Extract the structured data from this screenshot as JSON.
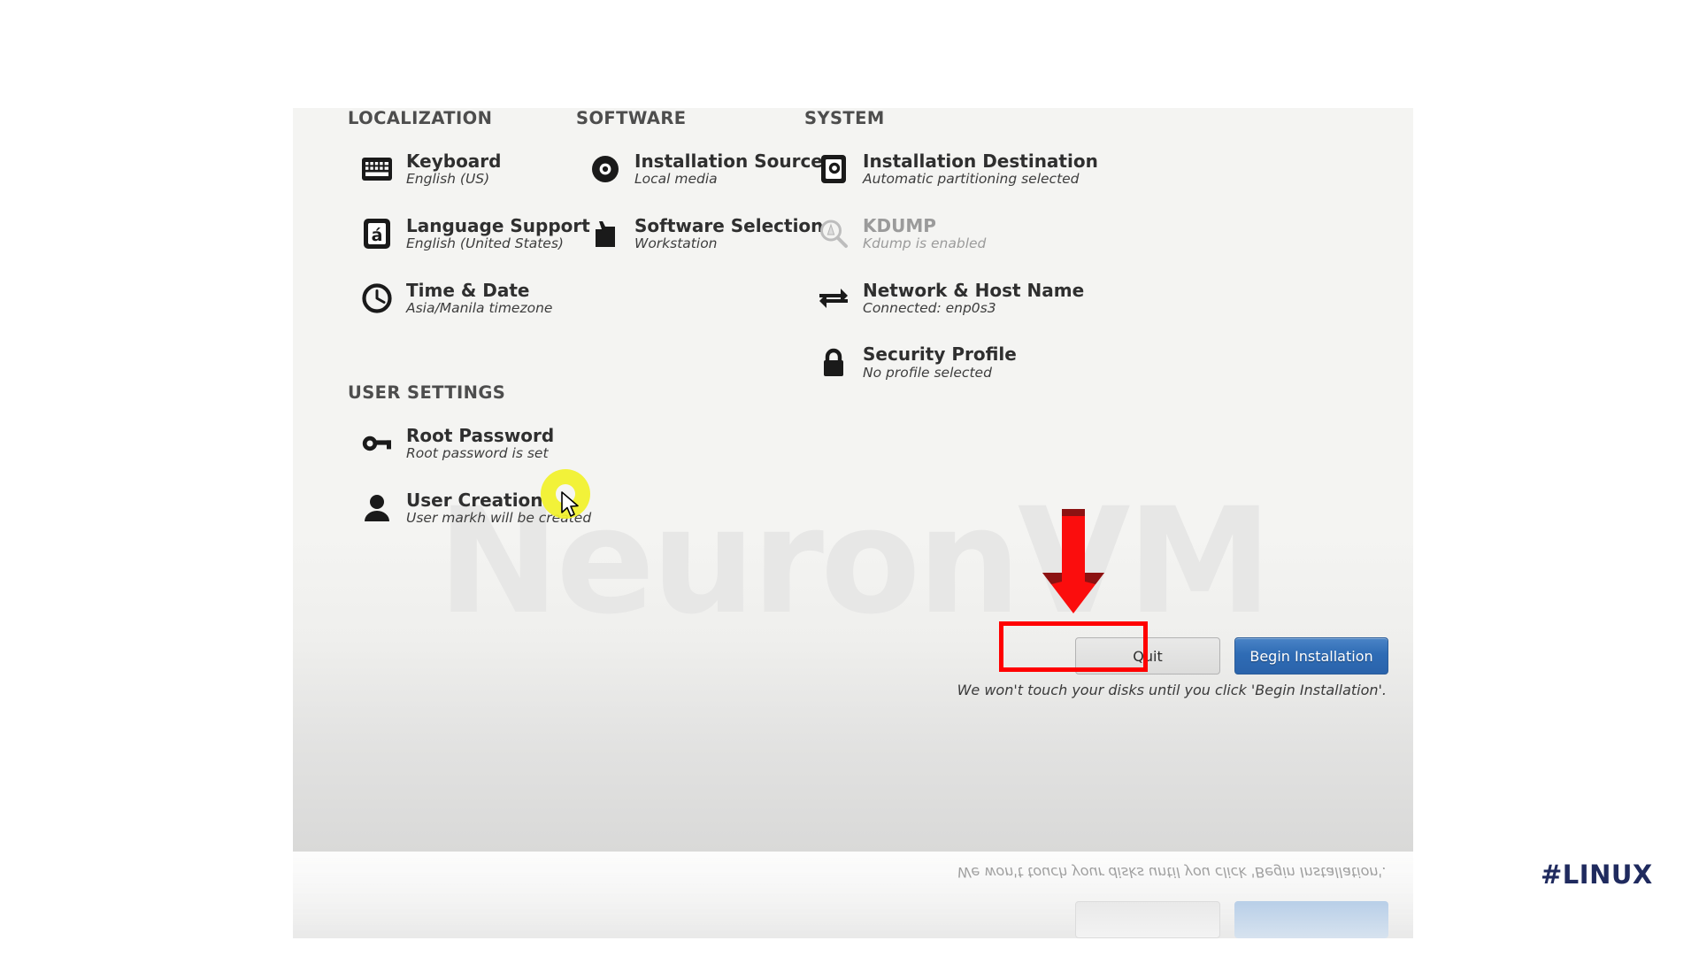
{
  "installer": {
    "sections": [
      {
        "id": "localization",
        "title": "LOCALIZATION",
        "items": [
          {
            "icon": "keyboard-icon",
            "title": "Keyboard",
            "status": "English (US)",
            "enabled": true
          },
          {
            "icon": "language-icon",
            "title": "Language Support",
            "status": "English (United States)",
            "enabled": true
          },
          {
            "icon": "clock-icon",
            "title": "Time & Date",
            "status": "Asia/Manila timezone",
            "enabled": true
          }
        ]
      },
      {
        "id": "software",
        "title": "SOFTWARE",
        "items": [
          {
            "icon": "disc-icon",
            "title": "Installation Source",
            "status": "Local media",
            "enabled": true
          },
          {
            "icon": "package-icon",
            "title": "Software Selection",
            "status": "Workstation",
            "enabled": true
          }
        ]
      },
      {
        "id": "system",
        "title": "SYSTEM",
        "items": [
          {
            "icon": "harddrive-icon",
            "title": "Installation Destination",
            "status": "Automatic partitioning selected",
            "enabled": true
          },
          {
            "icon": "magnifier-icon",
            "title": "KDUMP",
            "status": "Kdump is enabled",
            "enabled": false
          },
          {
            "icon": "network-icon",
            "title": "Network & Host Name",
            "status": "Connected: enp0s3",
            "enabled": true
          },
          {
            "icon": "lock-icon",
            "title": "Security Profile",
            "status": "No profile selected",
            "enabled": true
          }
        ]
      },
      {
        "id": "user-settings",
        "title": "USER SETTINGS",
        "items": [
          {
            "icon": "key-icon",
            "title": "Root Password",
            "status": "Root password is set",
            "enabled": true
          },
          {
            "icon": "user-icon",
            "title": "User Creation",
            "status": "User markh will be created",
            "enabled": true
          }
        ]
      }
    ],
    "buttons": {
      "quit": "Quit",
      "begin": "Begin Installation"
    },
    "warning": "We won't touch your disks until you click 'Begin Installation'.",
    "watermark": "NeuronVM"
  },
  "annotations": {
    "highlight_color": "#ff0000",
    "arrow_color": "#ff0000",
    "click_ring_color": "#f2f22a",
    "tag": "#LINUX",
    "tag_color": "#1f2a5e"
  }
}
